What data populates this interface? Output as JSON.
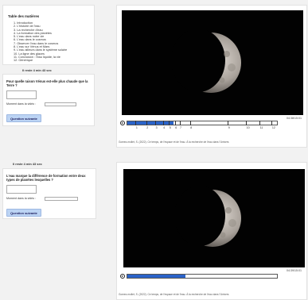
{
  "toc": {
    "title": "Table des matières",
    "items": [
      "1. Introduction",
      "2. L'histoire de l'eau",
      "3. La recherche d'eau",
      "4. La formation des planètes",
      "5. L'eau dans notre vie",
      "6. L'eau dans le cosmos",
      "7. Observer l'eau dans le cosmos",
      "8. L'eau sur Vénus et Mars",
      "9. L'eau ailleurs dans le système solaire",
      "10. La ligne des glaces",
      "11. Conclusion : l'eau liquide, la vie",
      "12. Générique"
    ]
  },
  "card1": {
    "timer": "Il reste 4 min 43 sec",
    "question": "Pour quelle raison Vénus est-elle plus chaude que la Terre ?",
    "moment_label": "Moment dans la vidéo :",
    "next_button": "Question suivante"
  },
  "card2": {
    "timer": "Il reste 4 min 43 sec",
    "question": "L'eau marque la différence de formation entre deux types de planètes lesquelles ?",
    "moment_label": "Moment dans la vidéo :",
    "next_button": "Question suivante"
  },
  "video1": {
    "time": "04:38/15:01",
    "progress": 0.31,
    "chapter_ticks": [
      "1",
      "2",
      "3",
      "4",
      "5",
      "6",
      "7",
      "8",
      "9",
      "10",
      "11",
      "12"
    ],
    "caption": "Gomez-mollet, S. (2022). Ce temps, de l'espace et de l'eau. À la recherche de l'eau dans l'Univers"
  },
  "video2": {
    "time": "04:39/15:01",
    "progress": 0.39,
    "caption": "Gomez-mollet, S. (2022). Ce temps, de l'espace et de l'eau. À la recherche de l'eau dans l'Univers"
  }
}
